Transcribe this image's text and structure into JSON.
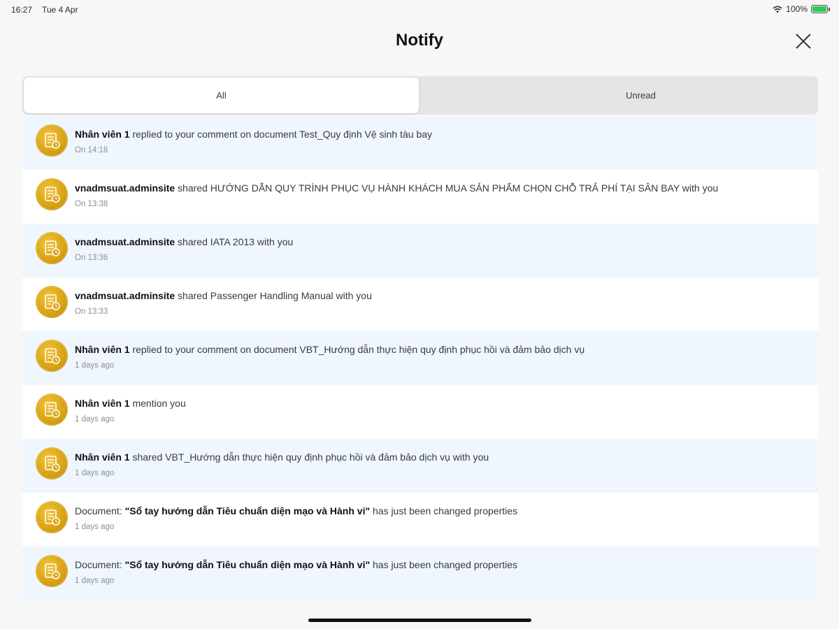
{
  "status_bar": {
    "time": "16:27",
    "date": "Tue 4 Apr",
    "battery": "100%"
  },
  "header": {
    "title": "Notify",
    "close_icon": "close-icon"
  },
  "tabs": [
    {
      "label": "All",
      "active": true
    },
    {
      "label": "Unread",
      "active": false
    }
  ],
  "notifications": [
    {
      "actor": "Nhân viên 1",
      "prefix": "",
      "bold": "",
      "text": " replied to your comment on document Test_Quy định Vệ sinh tàu bay",
      "time": "On 14:18"
    },
    {
      "actor": "vnadmsuat.adminsite",
      "prefix": "",
      "bold": "",
      "text": " shared HƯỚNG DẪN QUY TRÌNH PHỤC VỤ HÀNH KHÁCH MUA SẢN PHẨM CHỌN CHỖ TRẢ PHÍ TẠI SÂN BAY with you",
      "time": "On 13:38"
    },
    {
      "actor": "vnadmsuat.adminsite",
      "prefix": "",
      "bold": "",
      "text": " shared IATA 2013 with you",
      "time": "On 13:36"
    },
    {
      "actor": "vnadmsuat.adminsite",
      "prefix": "",
      "bold": "",
      "text": " shared Passenger Handling Manual with you",
      "time": "On 13:33"
    },
    {
      "actor": "Nhân viên 1",
      "prefix": "",
      "bold": "",
      "text": " replied to your comment on document VBT_Hướng dẫn thực hiện quy định phục hồi và đảm bảo dịch vụ",
      "time": "1 days ago"
    },
    {
      "actor": "Nhân viên 1",
      "prefix": "",
      "bold": "",
      "text": " mention you",
      "time": "1 days ago"
    },
    {
      "actor": "Nhân viên 1",
      "prefix": "",
      "bold": "",
      "text": " shared VBT_Hướng dẫn thực hiện quy định phục hồi và đảm bảo dịch vụ with you",
      "time": "1 days ago"
    },
    {
      "actor": "",
      "prefix": "Document: ",
      "bold": "\"Sổ tay hướng dẫn Tiêu chuẩn diện mạo và Hành vi\"",
      "text": " has just been changed properties",
      "time": "1 days ago"
    },
    {
      "actor": "",
      "prefix": "Document: ",
      "bold": "\"Sổ tay hướng dẫn Tiêu chuẩn diện mạo và Hành vi\"",
      "text": " has just been changed properties",
      "time": "1 days ago"
    }
  ],
  "colors": {
    "accent_gold": "#d9a414",
    "row_highlight": "#eff6fd",
    "battery_green": "#34c759"
  }
}
